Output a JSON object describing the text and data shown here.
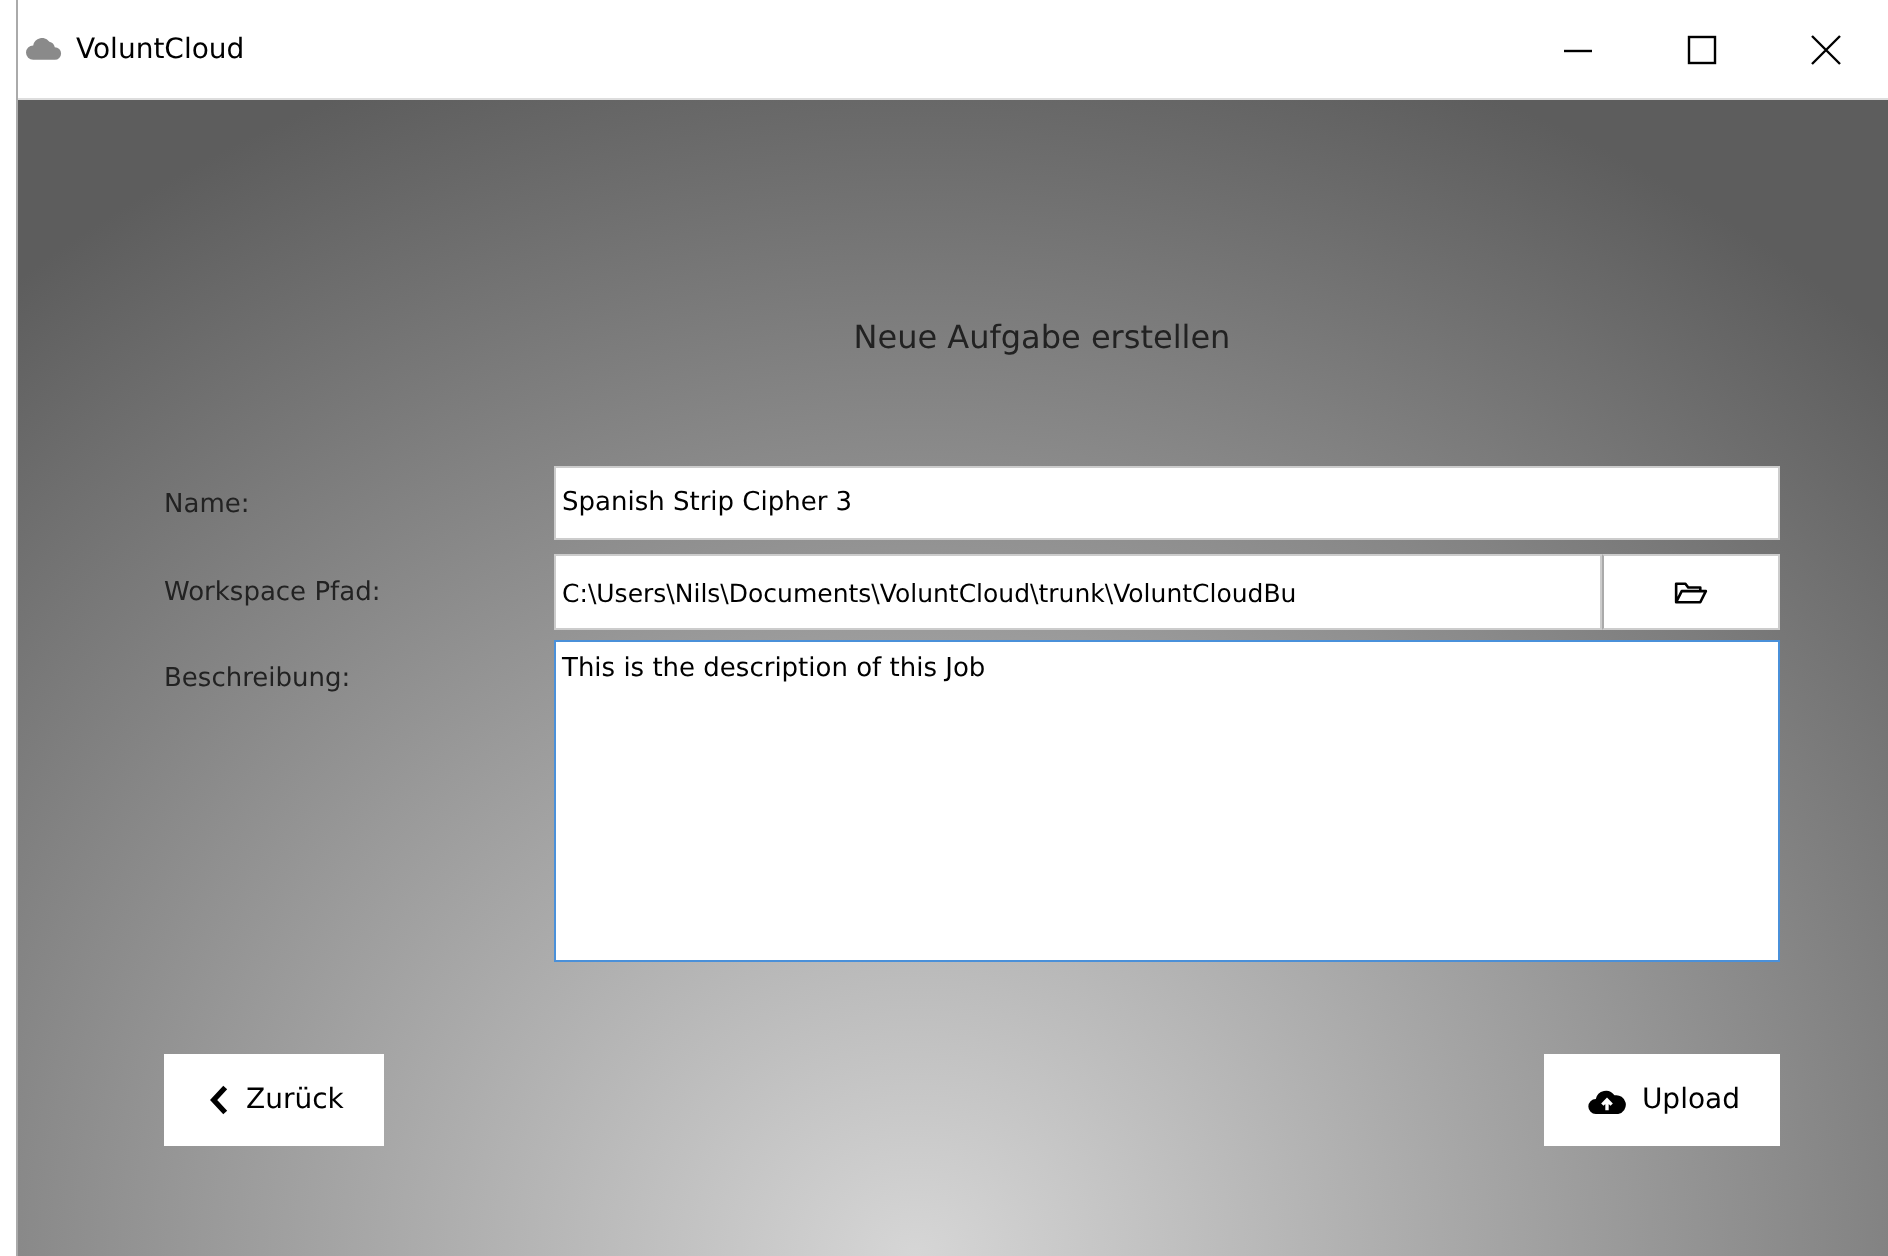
{
  "window": {
    "title": "VoluntCloud"
  },
  "heading": "Neue Aufgabe erstellen",
  "form": {
    "fields": [
      {
        "kind": "text",
        "label": "Name:",
        "value": "Spanish Strip Cipher 3"
      },
      {
        "kind": "path",
        "label": "Workspace Pfad:",
        "value": "C:\\Users\\Nils\\Documents\\VoluntCloud\\trunk\\VoluntCloudBu"
      },
      {
        "kind": "multiline",
        "label": "Beschreibung:",
        "value": "This is the description of this Job"
      }
    ]
  },
  "buttons": [
    {
      "kind": "back",
      "label": "Zurück"
    },
    {
      "kind": "upload",
      "label": "Upload"
    }
  ]
}
